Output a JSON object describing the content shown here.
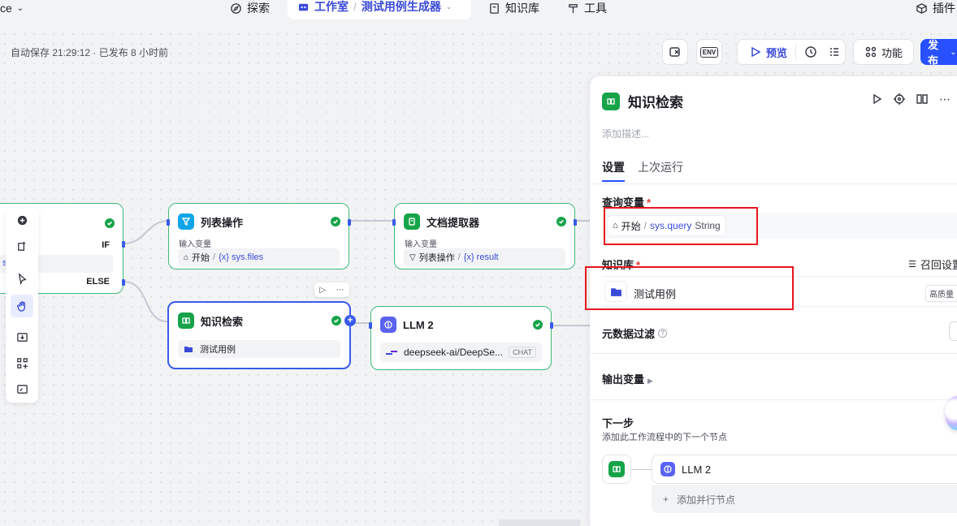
{
  "topbar": {
    "left_cut": "ce",
    "explore": "探索",
    "workspace": "工作室",
    "project": "测试用例生成器",
    "knowledge": "知识库",
    "tools": "工具",
    "plugins": "插件"
  },
  "autosave": "自动保存 21:29:12 · 已发布 8 小时前",
  "toolbar": {
    "env": "ENV",
    "preview": "预览",
    "features": "功能",
    "publish": "发布"
  },
  "canvas": {
    "cond_node": {
      "if": "IF",
      "else": "ELSE",
      "cut_text": "s"
    },
    "list_node": {
      "title": "列表操作",
      "label": "输入变量",
      "source": "开始",
      "var": "{x} sys.files"
    },
    "doc_node": {
      "title": "文档提取器",
      "label": "输入变量",
      "source": "列表操作",
      "var": "{x} result"
    },
    "kb_node": {
      "title": "知识检索",
      "kb": "测试用例"
    },
    "llm_node": {
      "title": "LLM 2",
      "model": "deepseek-ai/DeepSe...",
      "mode": "CHAT"
    }
  },
  "panel": {
    "title": "知识检索",
    "desc_placeholder": "添加描述...",
    "tabs": [
      "设置",
      "上次运行"
    ],
    "query_label": "查询变量",
    "query_source": "开始",
    "query_var": "sys.query",
    "query_type": "String",
    "kb_label": "知识库",
    "recall_settings": "召回设置",
    "kb_name": "测试用例",
    "kb_quality": "高质量 · 向",
    "meta_filter": "元数据过滤",
    "output_vars": "输出变量",
    "next_step": "下一步",
    "next_step_desc": "添加此工作流程中的下一个节点",
    "next_node": "LLM 2",
    "add_parallel": "添加并行节点"
  },
  "colors": {
    "accent": "#2850ff",
    "success": "#17a34a",
    "highlight": "#e8151f"
  }
}
